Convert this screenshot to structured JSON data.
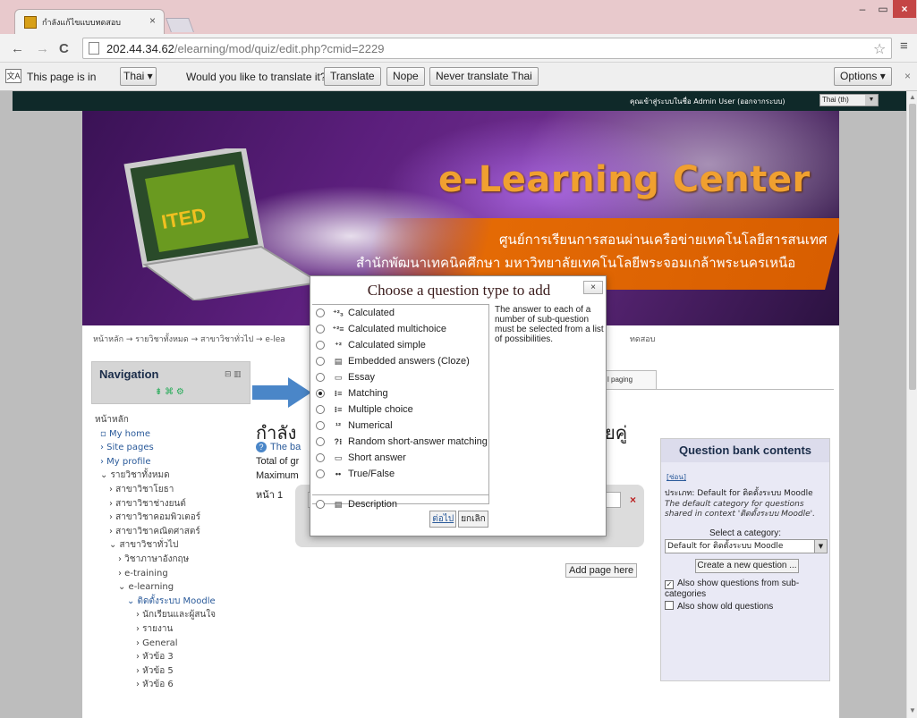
{
  "browser": {
    "tab_title": "กำลังแก้ไขแบบทดสอบ",
    "tab_close": "×",
    "url_host": "202.44.34.62",
    "url_path": "/elearning/mod/quiz/edit.php?cmid=2229",
    "back": "←",
    "forward": "→",
    "reload": "C",
    "star": "☆",
    "menu": "≡",
    "win_min": "–",
    "win_max": "▭",
    "win_close": "×"
  },
  "translate_bar": {
    "prefix": "This page is in",
    "language": "Thai ▾",
    "question": "Would you like to translate it?",
    "translate": "Translate",
    "nope": "Nope",
    "never": "Never translate Thai",
    "options": "Options ▾",
    "close": "×"
  },
  "site": {
    "login_info": "คุณเข้าสู่ระบบในชื่อ Admin User (ออกจากระบบ)",
    "lang_selected": "Thai (th)",
    "banner_title": "e-Learning Center",
    "banner_sub1": "ศูนย์การเรียนการสอนผ่านเครือข่ายเทคโนโลยีสารสนเทศ",
    "banner_sub2": "สำนักพัฒนาเทคนิคศึกษา มหาวิทยาลัยเทคโนโลยีพระจอมเกล้าพระนครเหนือ",
    "laptop_text": "ITED",
    "breadcrumb": "หน้าหลัก → รายวิชาทั้งหมด → สาขาวิชาทั่วไป → e-lea",
    "breadcrumb_end": "ทดสอบ"
  },
  "navigation": {
    "title": "Navigation",
    "ctrl": "⊟ ▥",
    "tools": "⇟ ⌘ ⚙",
    "items": [
      {
        "label": "หน้าหลัก"
      },
      {
        "label": "▫ My home"
      },
      {
        "label": "› Site pages"
      },
      {
        "label": "› My profile"
      },
      {
        "label": "⌄ รายวิชาทั้งหมด"
      },
      {
        "label": "› สาขาวิชาโยธา"
      },
      {
        "label": "› สาขาวิชาช่างยนต์"
      },
      {
        "label": "› สาขาวิชาคอมพิวเตอร์"
      },
      {
        "label": "› สาขาวิชาคณิตศาสตร์"
      },
      {
        "label": "⌄ สาขาวิชาทั่วไป"
      },
      {
        "label": "› วิชาภาษาอังกฤษ"
      },
      {
        "label": "› e-training"
      },
      {
        "label": "⌄ e-learning"
      },
      {
        "label": "⌄ ติดตั้งระบบ Moodle"
      },
      {
        "label": "› นักเรียนและผู้สนใจ"
      },
      {
        "label": "› รายงาน"
      },
      {
        "label": "› General"
      },
      {
        "label": "› หัวข้อ 3"
      },
      {
        "label": "› หัวข้อ 5"
      },
      {
        "label": "› หัวข้อ 6"
      }
    ]
  },
  "main": {
    "tab_paging": "l paging",
    "heading_left": "กำลัง",
    "heading_right": "ยคู่",
    "help_text": "The ba",
    "help_q": "?",
    "total_grade": "Total of gr",
    "max_grade": "Maximum",
    "page_label": "หน้า 1",
    "edit_value": "Er",
    "edit_x": "×",
    "add_page": "Add page here"
  },
  "question_bank": {
    "title": "Question bank contents",
    "hide": "[ซ่อน]",
    "category_line": "ประเภท: Default for ติดตั้งระบบ Moodle",
    "description": "The default category for questions shared in context 'ติดตั้งระบบ Moodle'.",
    "select_label": "Select a category:",
    "select_value": "Default for ติดตั้งระบบ Moodle",
    "create_button": "Create a new question ...",
    "show_sub": "Also show questions from sub-categories",
    "show_old": "Also show old questions",
    "check_mark": "✓"
  },
  "dialog": {
    "title": "Choose a question type to add",
    "close": "×",
    "description": "The answer to each of a number of sub-question must be selected from a list of possibilities.",
    "next": "ต่อไป",
    "cancel": "ยกเลิก",
    "types": [
      {
        "label": "Calculated",
        "icon": "⁺²₃"
      },
      {
        "label": "Calculated multichoice",
        "icon": "⁺²≡"
      },
      {
        "label": "Calculated simple",
        "icon": "⁺²"
      },
      {
        "label": "Embedded answers (Cloze)",
        "icon": "▤"
      },
      {
        "label": "Essay",
        "icon": "▭"
      },
      {
        "label": "Matching",
        "icon": "⁝≡"
      },
      {
        "label": "Multiple choice",
        "icon": "⁝≡"
      },
      {
        "label": "Numerical",
        "icon": "¹²"
      },
      {
        "label": "Random short-answer matching",
        "icon": "?⁝"
      },
      {
        "label": "Short answer",
        "icon": "▭"
      },
      {
        "label": "True/False",
        "icon": "••"
      },
      {
        "label": "Description",
        "icon": "▤"
      }
    ],
    "selected_index": 5
  },
  "colors": {
    "banner_title": "#f0a030",
    "banner_orange": "#e46a05",
    "top_strip": "#0f2929",
    "link": "#2a5a9a",
    "arrow": "#4a86c8"
  }
}
